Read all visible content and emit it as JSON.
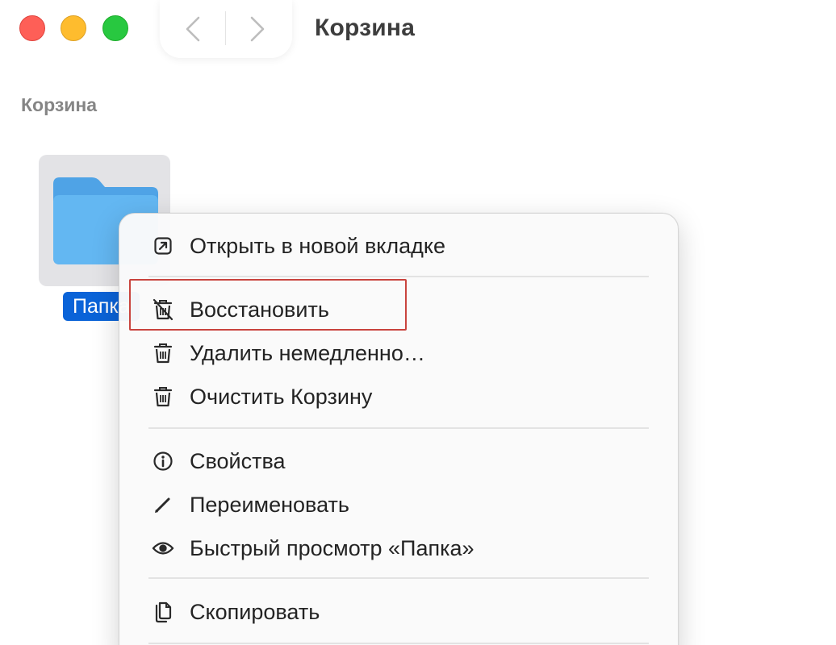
{
  "window": {
    "title": "Корзина"
  },
  "sidebar": {
    "section_title": "Корзина"
  },
  "files": [
    {
      "name": "Папка",
      "selected": true,
      "icon": "folder-icon",
      "color": "#5ab0ef"
    }
  ],
  "context_menu": {
    "items": [
      {
        "label": "Открыть в новой вкладке",
        "icon": "open-in-new-tab-icon"
      },
      {
        "label": "Восстановить",
        "icon": "restore-from-trash-icon"
      },
      {
        "label": "Удалить немедленно…",
        "icon": "trash-icon"
      },
      {
        "label": "Очистить Корзину",
        "icon": "trash-icon"
      },
      {
        "label": "Свойства",
        "icon": "info-icon"
      },
      {
        "label": "Переименовать",
        "icon": "pencil-icon"
      },
      {
        "label": "Быстрый просмотр «Папка»",
        "icon": "eye-icon"
      },
      {
        "label": "Скопировать",
        "icon": "copy-icon"
      }
    ]
  },
  "colors": {
    "selection": "#0a63d8",
    "highlight_outline": "#c9443e",
    "close": "#fe5f57",
    "minimize": "#febc2e",
    "zoom": "#28c840"
  }
}
